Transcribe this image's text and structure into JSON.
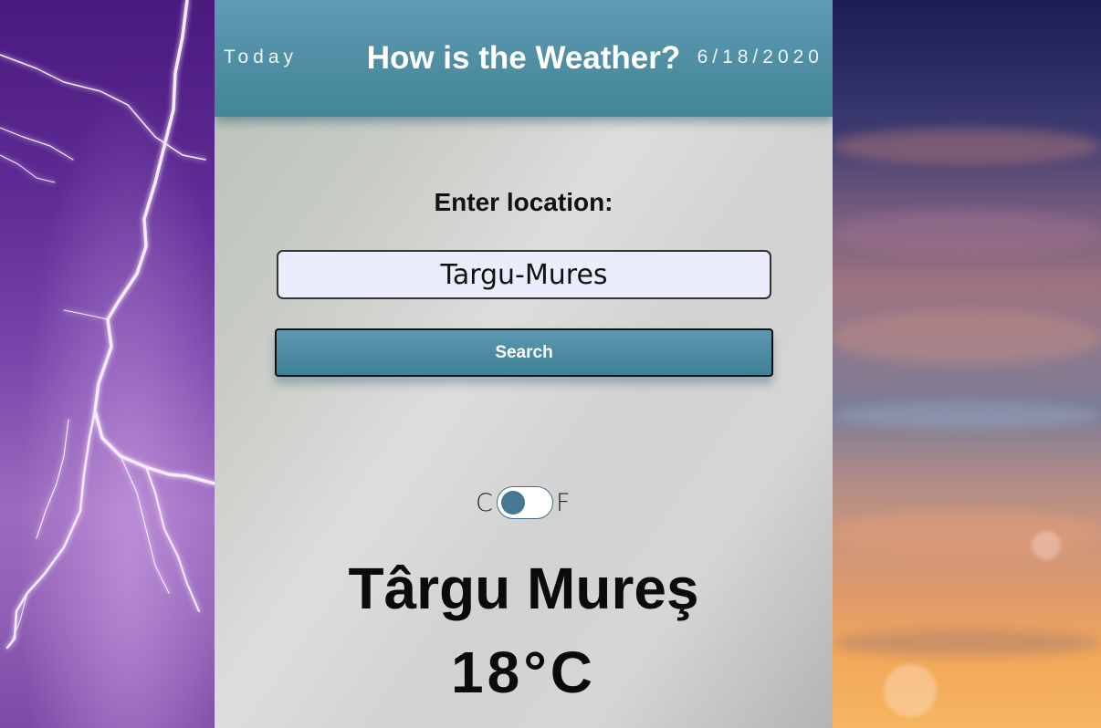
{
  "header": {
    "today_label": "Today",
    "title": "How is the Weather?",
    "date": "6/18/2020"
  },
  "search": {
    "label": "Enter location:",
    "value": "Targu-Mures",
    "button_label": "Search"
  },
  "units": {
    "celsius_label": "C",
    "fahrenheit_label": "F",
    "selected": "C"
  },
  "result": {
    "city": "Târgu Mureş",
    "temperature": "18",
    "degree_symbol": "°",
    "unit": "C"
  },
  "colors": {
    "header_accent": "#4f8ea3",
    "button_accent": "#4d8ca2",
    "toggle_knob": "#457891",
    "input_background": "#ebedfc"
  },
  "icons": {
    "toggle": "unit-toggle-switch"
  }
}
